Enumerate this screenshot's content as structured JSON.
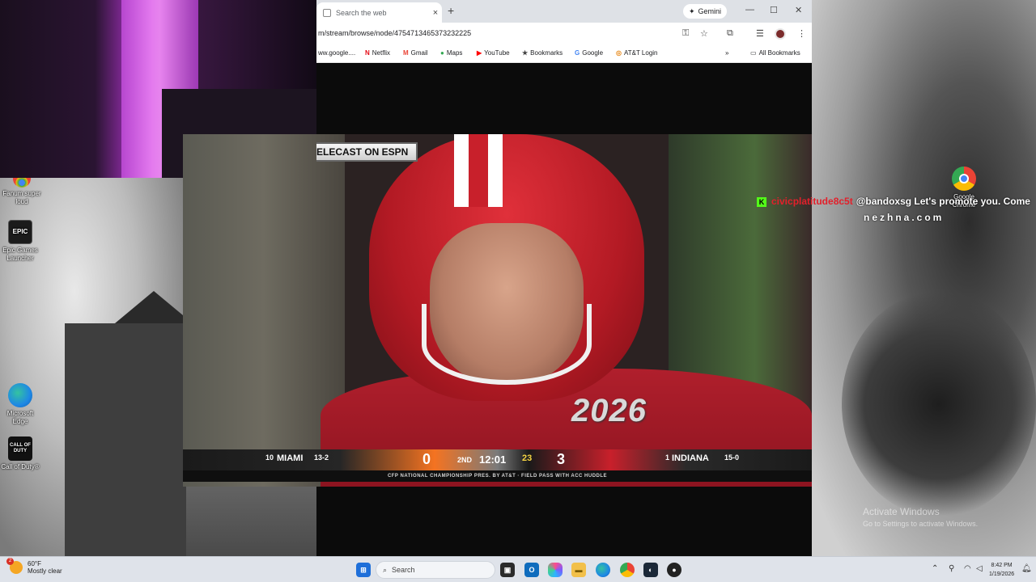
{
  "desktop": {
    "icons": [
      {
        "label": "Fanum super loud"
      },
      {
        "label": "Epic Games Launcher",
        "glyph": "EPIC"
      },
      {
        "label": "Microsoft Edge"
      },
      {
        "label": "Call of Duty®",
        "glyph": "CALL OF DUTY"
      },
      {
        "label": "Google Chrome"
      }
    ],
    "activate_windows": {
      "title": "Activate Windows",
      "subtitle": "Go to Settings to activate Windows."
    }
  },
  "chrome": {
    "tab": {
      "title": "Search the web",
      "close": "×"
    },
    "newtab": "+",
    "gemini_label": "Gemini",
    "window_controls": {
      "minimize": "—",
      "maximize": "☐",
      "close": "✕"
    },
    "url": "m/stream/browse/node/4754713465373232225",
    "bookmarks": [
      {
        "label": "ww.google...."
      },
      {
        "label": "Netflix",
        "glyph": "N"
      },
      {
        "label": "Gmail",
        "glyph": "M"
      },
      {
        "label": "Maps",
        "glyph": "●"
      },
      {
        "label": "YouTube",
        "glyph": "▶"
      },
      {
        "label": "Bookmarks",
        "glyph": "★"
      },
      {
        "label": "Google",
        "glyph": "G"
      },
      {
        "label": "AT&T Login",
        "glyph": "◎"
      }
    ],
    "more_bookmarks": "»",
    "all_bookmarks": "All Bookmarks"
  },
  "video": {
    "telecast_tag": "ELECAST ON ESPN",
    "jersey_logo": "2026",
    "scoreboard": {
      "away_rank": "10",
      "away_team": "MIAMI",
      "away_record": "13-2",
      "away_score": "0",
      "quarter": "2ND",
      "clock": "12:01",
      "play_clock": "23",
      "home_score": "3",
      "home_rank": "1",
      "home_team": "INDIANA",
      "home_record": "15-0",
      "sponsor_line": "CFP NATIONAL CHAMPIONSHIP PRES. BY AT&T · FIELD PASS WITH ACC HUDDLE"
    }
  },
  "chat": {
    "badge": "K",
    "username": "civicplatitude8c5t",
    "message": "@bandoxsg Let's promote you. Come",
    "line2": "nezhna.com"
  },
  "taskbar": {
    "weather_temp": "60°F",
    "weather_desc": "Mostly clear",
    "weather_badge": "2",
    "search_placeholder": "Search",
    "time": "8:42 PM",
    "date": "1/19/2026"
  }
}
